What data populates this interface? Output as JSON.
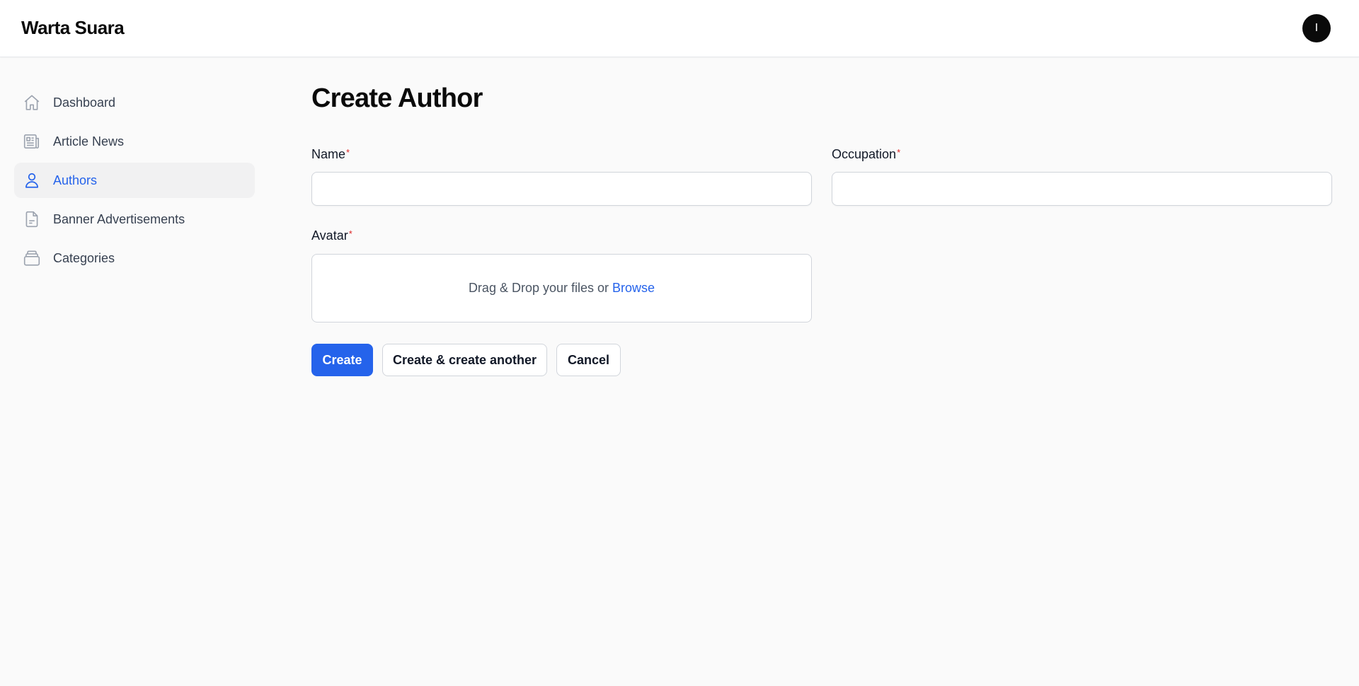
{
  "header": {
    "brand": "Warta Suara",
    "user_initial": "I"
  },
  "sidebar": {
    "items": [
      {
        "label": "Dashboard",
        "icon": "home-icon",
        "active": false
      },
      {
        "label": "Article News",
        "icon": "newspaper-icon",
        "active": false
      },
      {
        "label": "Authors",
        "icon": "user-icon",
        "active": true
      },
      {
        "label": "Banner Advertisements",
        "icon": "document-icon",
        "active": false
      },
      {
        "label": "Categories",
        "icon": "stack-icon",
        "active": false
      }
    ]
  },
  "main": {
    "title": "Create Author",
    "form": {
      "name": {
        "label": "Name",
        "required_mark": "*",
        "value": ""
      },
      "occupation": {
        "label": "Occupation",
        "required_mark": "*",
        "value": ""
      },
      "avatar": {
        "label": "Avatar",
        "required_mark": "*",
        "drop_text": "Drag & Drop your files or",
        "browse_label": "Browse"
      }
    },
    "actions": {
      "create_label": "Create",
      "create_another_label": "Create & create another",
      "cancel_label": "Cancel"
    }
  },
  "colors": {
    "accent": "#2563eb",
    "required": "#dc2626",
    "background": "#fafafa"
  }
}
